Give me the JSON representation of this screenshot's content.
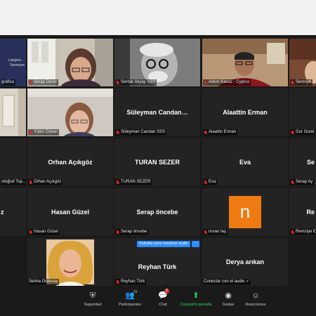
{
  "tiles": [
    {
      "label": "gráfica",
      "center": "",
      "mic": false,
      "overlay": "Langres…\nSemeyes"
    },
    {
      "label": "Serap Deniz",
      "center": "",
      "mic": true
    },
    {
      "label": "Serdar Akyay SSS",
      "center": "",
      "mic": true
    },
    {
      "label": "Adem Kavaz - Cyprus",
      "center": "",
      "mic": true
    },
    {
      "label": "Semriye",
      "center": "",
      "mic": true
    },
    {
      "label": "",
      "center": "",
      "mic": false
    },
    {
      "label": "Yıldız Özkan",
      "center": "",
      "mic": true
    },
    {
      "label": "Süleyman Candan SSS",
      "center": "Süleyman  Candan…",
      "mic": true
    },
    {
      "label": "Alaattin Erman",
      "center": "Alaattin Erman",
      "mic": true
    },
    {
      "label": "Gur Gurel",
      "center": "",
      "mic": true
    },
    {
      "label": "otoğraf Top…",
      "center": "",
      "mic": false
    },
    {
      "label": "Orhan Açıkgöz",
      "center": "Orhan Açıkgöz",
      "mic": true
    },
    {
      "label": "TURAN SEZER",
      "center": "TURAN SEZER",
      "mic": true
    },
    {
      "label": "Eva",
      "center": "Eva",
      "mic": true
    },
    {
      "label": "Serap Ay",
      "center": "Se",
      "mic": true
    },
    {
      "label": "",
      "center": "z",
      "mic": false
    },
    {
      "label": "Hasan Güzel",
      "center": "Hasan Güzel",
      "mic": true
    },
    {
      "label": "Serap öncebe",
      "center": "Serap öncebe",
      "mic": true
    },
    {
      "label": "nuran taş",
      "center": "",
      "mic": true
    },
    {
      "label": "Remziye E",
      "center": "Re",
      "mic": true
    },
    {
      "label": "Selma Oransay",
      "center": "",
      "mic": false
    },
    {
      "label": "Reyhan Türk",
      "center": "Reyhan Türk",
      "mic": true
    },
    {
      "label": "Conectar con el audio ✓",
      "center": "Derya  arıkan",
      "mic": false
    }
  ],
  "tooltip": {
    "text": "Solicitar para reactivar audio",
    "more": "···"
  },
  "nlogo": "n",
  "toolbar": {
    "seguridad": "Seguridad",
    "participantes": "Participantes",
    "participantes_count": "31",
    "chat": "Chat",
    "chat_badge": "2",
    "compartir": "Compartir pantalla",
    "grabar": "Grabar",
    "reacciones": "Reacciones"
  },
  "colors": {
    "accent": "#2d8cff",
    "share_green": "#23d959",
    "muted": "#e02828",
    "bg": "#1a1a1a",
    "tile": "#232323"
  }
}
